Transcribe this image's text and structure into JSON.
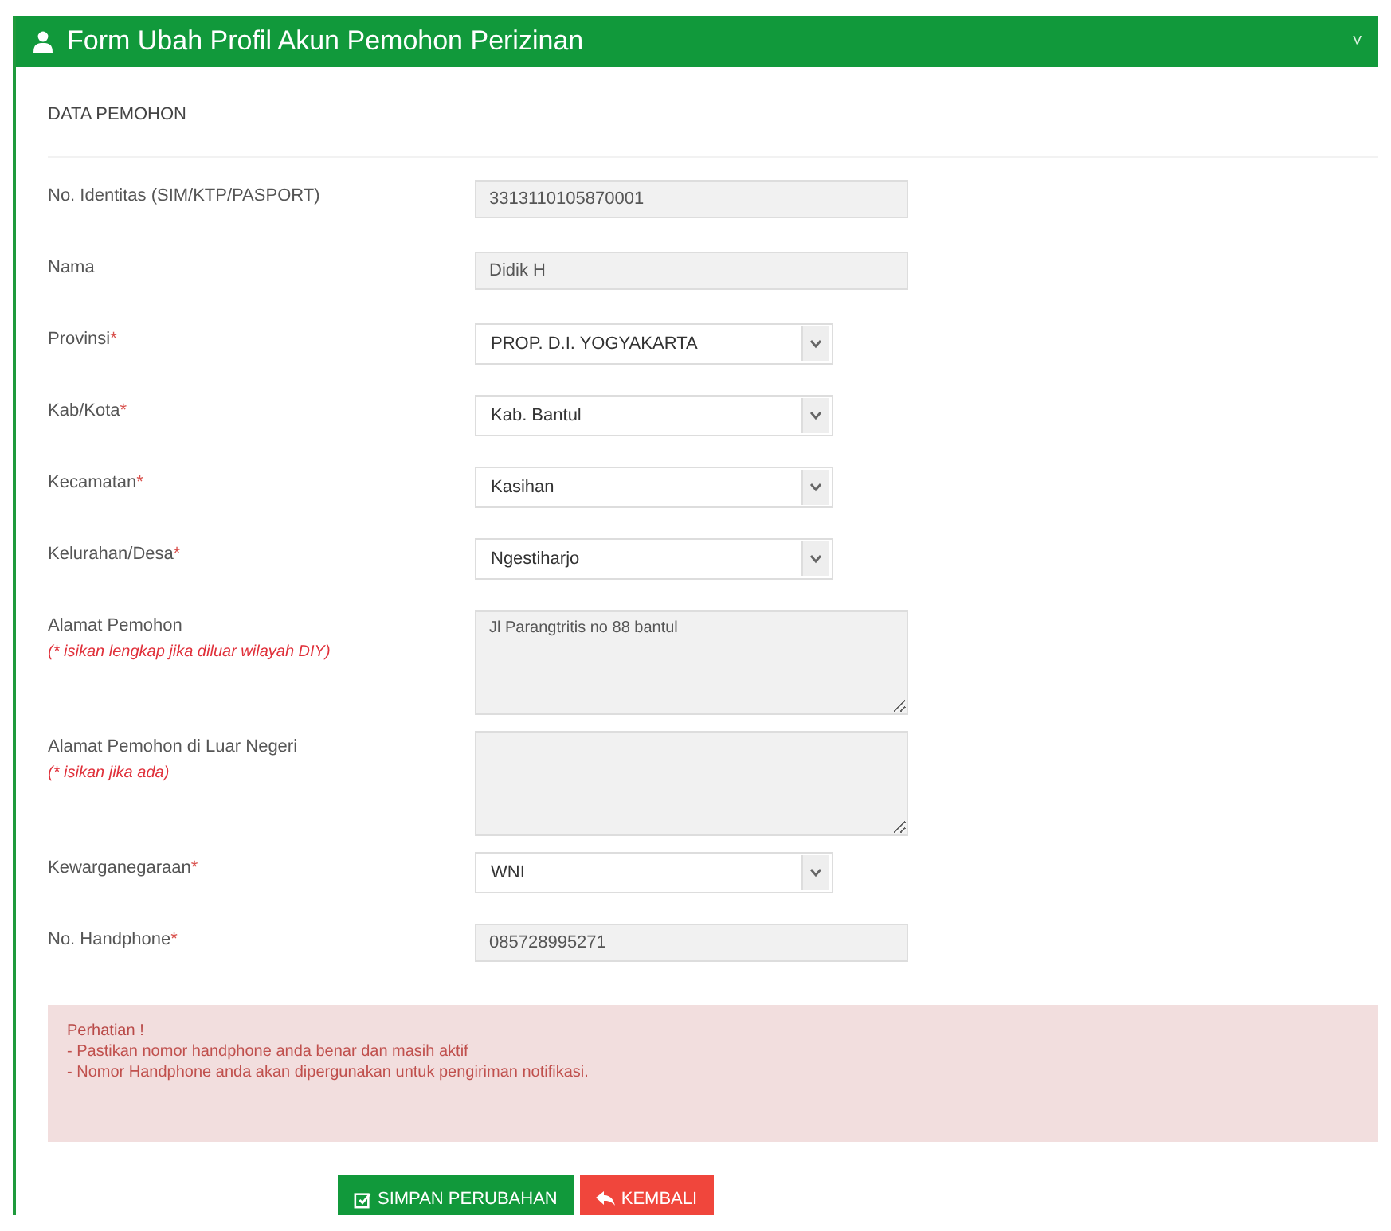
{
  "panel": {
    "title": "Form Ubah Profil Akun Pemohon Perizinan",
    "collapse_icon": "˅"
  },
  "section_title": "DATA PEMOHON",
  "fields": [
    {
      "kind": "text",
      "label": "No. Identitas (SIM/KTP/PASPORT)",
      "value": "3313110105870001"
    },
    {
      "kind": "text",
      "label": "Nama",
      "value": "Didik H"
    },
    {
      "kind": "select",
      "label": "Provinsi",
      "asterisk": "*",
      "value": "PROP. D.I. YOGYAKARTA"
    },
    {
      "kind": "select",
      "label": "Kab/Kota",
      "asterisk": "*",
      "value": "Kab. Bantul"
    },
    {
      "kind": "select",
      "label": "Kecamatan",
      "asterisk": "*",
      "value": "Kasihan"
    },
    {
      "kind": "select",
      "label": "Kelurahan/Desa",
      "asterisk": "*",
      "value": "Ngestiharjo"
    },
    {
      "kind": "textarea",
      "label": "Alamat Pemohon",
      "note": "(* isikan lengkap jika diluar wilayah DIY)",
      "value": "Jl Parangtritis no 88 bantul"
    },
    {
      "kind": "textarea",
      "label": "Alamat Pemohon di Luar Negeri",
      "note": "(* isikan jika ada)"
    },
    {
      "kind": "select",
      "label": "Kewarganegaraan",
      "asterisk": "*",
      "value": "WNI"
    },
    {
      "kind": "text",
      "label": "No. Handphone",
      "asterisk": "*",
      "value": "085728995271"
    }
  ],
  "alert": {
    "title": "Perhatian !",
    "lines": [
      "- Pastikan nomor handphone anda benar dan masih aktif",
      "- Nomor Handphone anda akan dipergunakan untuk pengiriman notifikasi."
    ]
  },
  "buttons": [
    {
      "kind": "save",
      "label": "SIMPAN PERUBAHAN"
    },
    {
      "kind": "back",
      "label": "KEMBALI"
    }
  ]
}
